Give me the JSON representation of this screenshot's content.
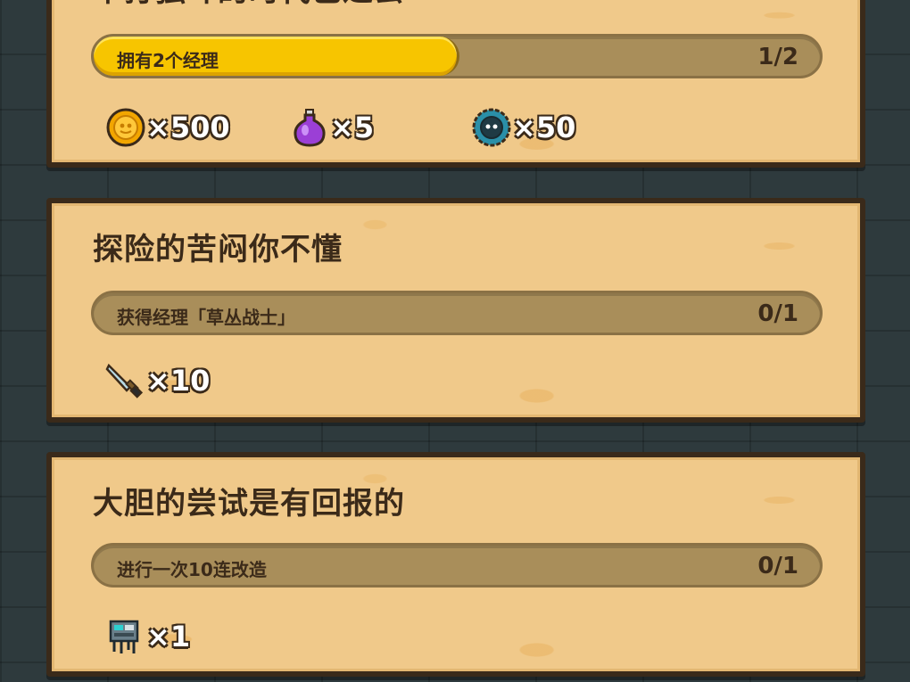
{
  "quests": [
    {
      "title": "单打独斗的时代已过去",
      "objective": "拥有2个经理",
      "progress": "1/2",
      "progress_fraction": 0.5,
      "rewards": [
        {
          "icon": "gold-coin-icon",
          "qty": "×500"
        },
        {
          "icon": "purple-potion-icon",
          "qty": "×5"
        },
        {
          "icon": "blue-gear-token-icon",
          "qty": "×50"
        }
      ]
    },
    {
      "title": "探险的苦闷你不懂",
      "objective": "获得经理「草丛战士」",
      "progress": "0/1",
      "progress_fraction": 0,
      "rewards": [
        {
          "icon": "dagger-icon",
          "qty": "×10"
        }
      ]
    },
    {
      "title": "大胆的尝试是有回报的",
      "objective": "进行一次10连改造",
      "progress": "0/1",
      "progress_fraction": 0,
      "rewards": [
        {
          "icon": "robot-machine-icon",
          "qty": "×1"
        }
      ]
    }
  ],
  "colors": {
    "background": "#2e3a3d",
    "card": "#f0c98a",
    "progress_fill": "#f7c500",
    "progress_track": "#a98e5a",
    "text_dark": "#3b2a19"
  }
}
